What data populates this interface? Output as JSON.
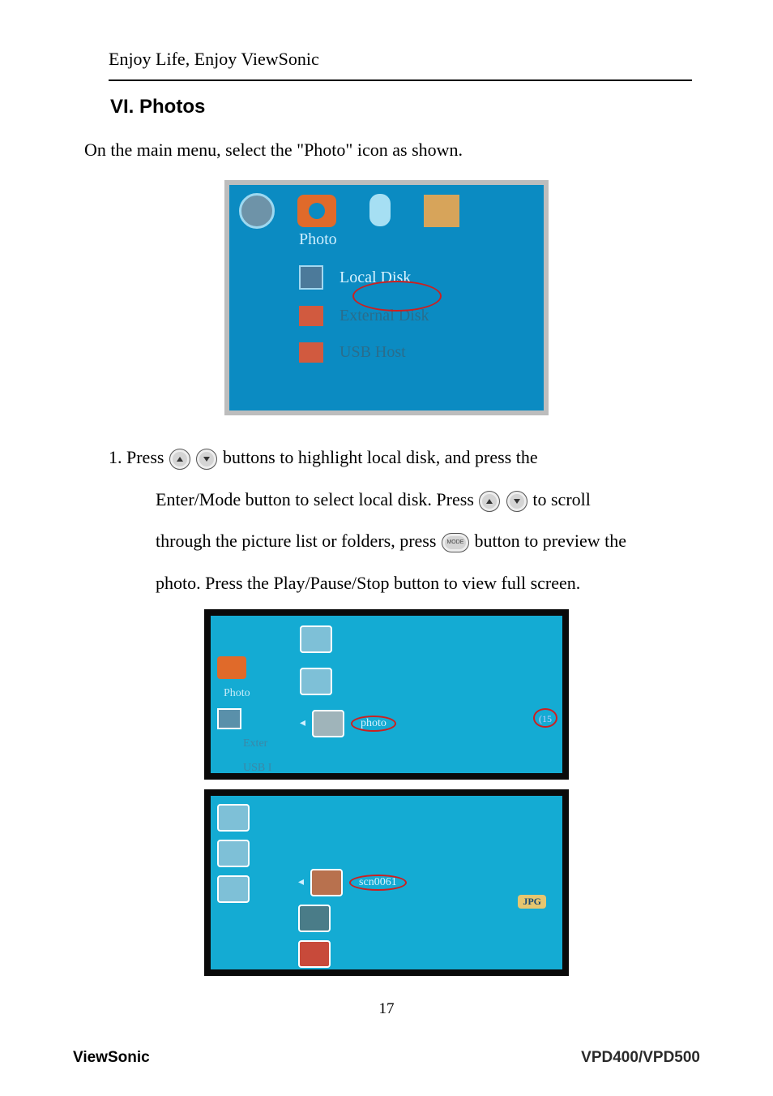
{
  "header": {
    "tagline": "Enjoy Life, Enjoy ViewSonic"
  },
  "section": {
    "title": "VI. Photos"
  },
  "intro": "On the main menu, select the \"Photo\" icon as shown.",
  "screenshot1": {
    "label": "Photo",
    "items": [
      "Local Disk",
      "External Disk",
      "USB Host"
    ]
  },
  "step1": {
    "num": "1.",
    "line1a": "Press ",
    "line1b": " buttons to highlight local disk, and press the",
    "line2a": "Enter/Mode button to select local disk. Press ",
    "line2b": "   to scroll",
    "line3a": "through the picture list or folders, press ",
    "line3b": " button to preview the",
    "line4": "photo. Press the Play/Pause/Stop button to view full screen."
  },
  "screenshot2a": {
    "photoLabel": "Photo",
    "folderLabel": "photo",
    "count": "(15",
    "exterLabel": "Exter",
    "usbLabel": "USB I"
  },
  "screenshot2b": {
    "fileLabel": "scn0061",
    "badge": "JPG"
  },
  "pageNumber": "17",
  "footer": {
    "brand": "ViewSonic",
    "model": "VPD400/VPD500"
  }
}
